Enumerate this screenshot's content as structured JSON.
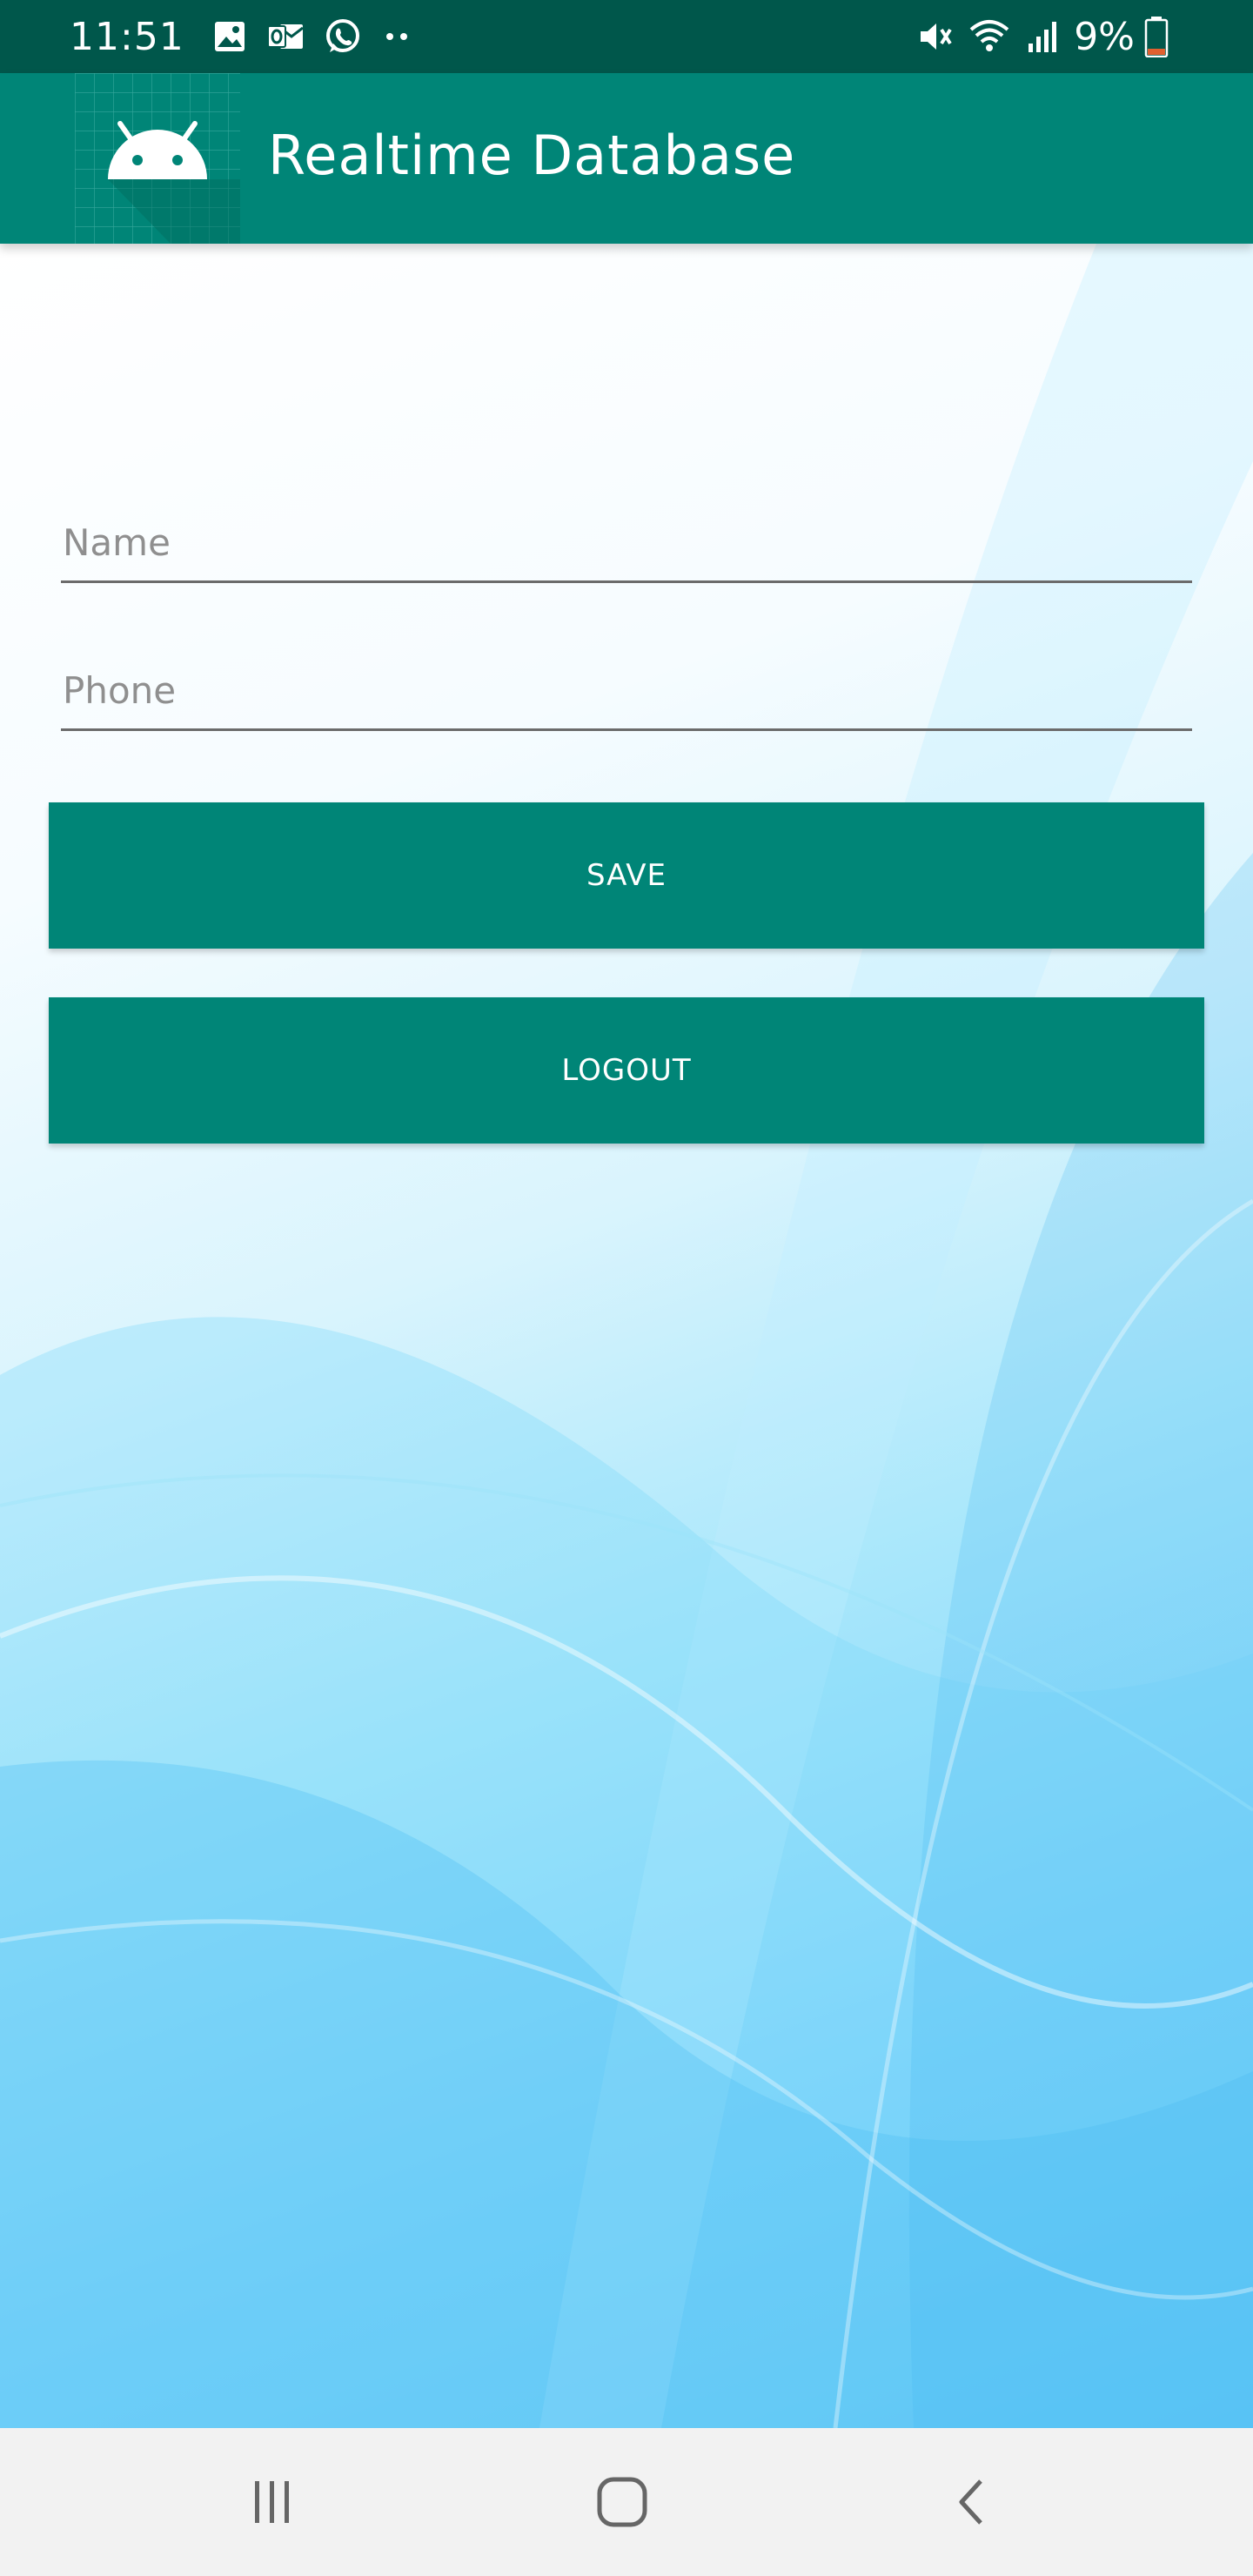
{
  "status_bar": {
    "time": "11:51",
    "battery_percent": "9%",
    "left_icons": [
      "image-icon",
      "outlook-icon",
      "whatsapp-icon",
      "more-dots-icon"
    ],
    "right_icons": [
      "mute-icon",
      "wifi-icon",
      "signal-icon",
      "battery-icon"
    ],
    "battery_level": 0.09
  },
  "app_bar": {
    "title": "Realtime Database",
    "logo_icon": "android-icon"
  },
  "form": {
    "name_placeholder": "Name",
    "name_value": "",
    "phone_placeholder": "Phone",
    "phone_value": ""
  },
  "buttons": {
    "save_label": "SAVE",
    "logout_label": "LOGOUT"
  },
  "nav_bar": {
    "items": [
      "recent-apps-icon",
      "home-icon",
      "back-icon"
    ]
  },
  "colors": {
    "status_bar": "#00574B",
    "app_bar": "#008577",
    "button": "#008577",
    "nav_bar": "#f2f2f2"
  }
}
